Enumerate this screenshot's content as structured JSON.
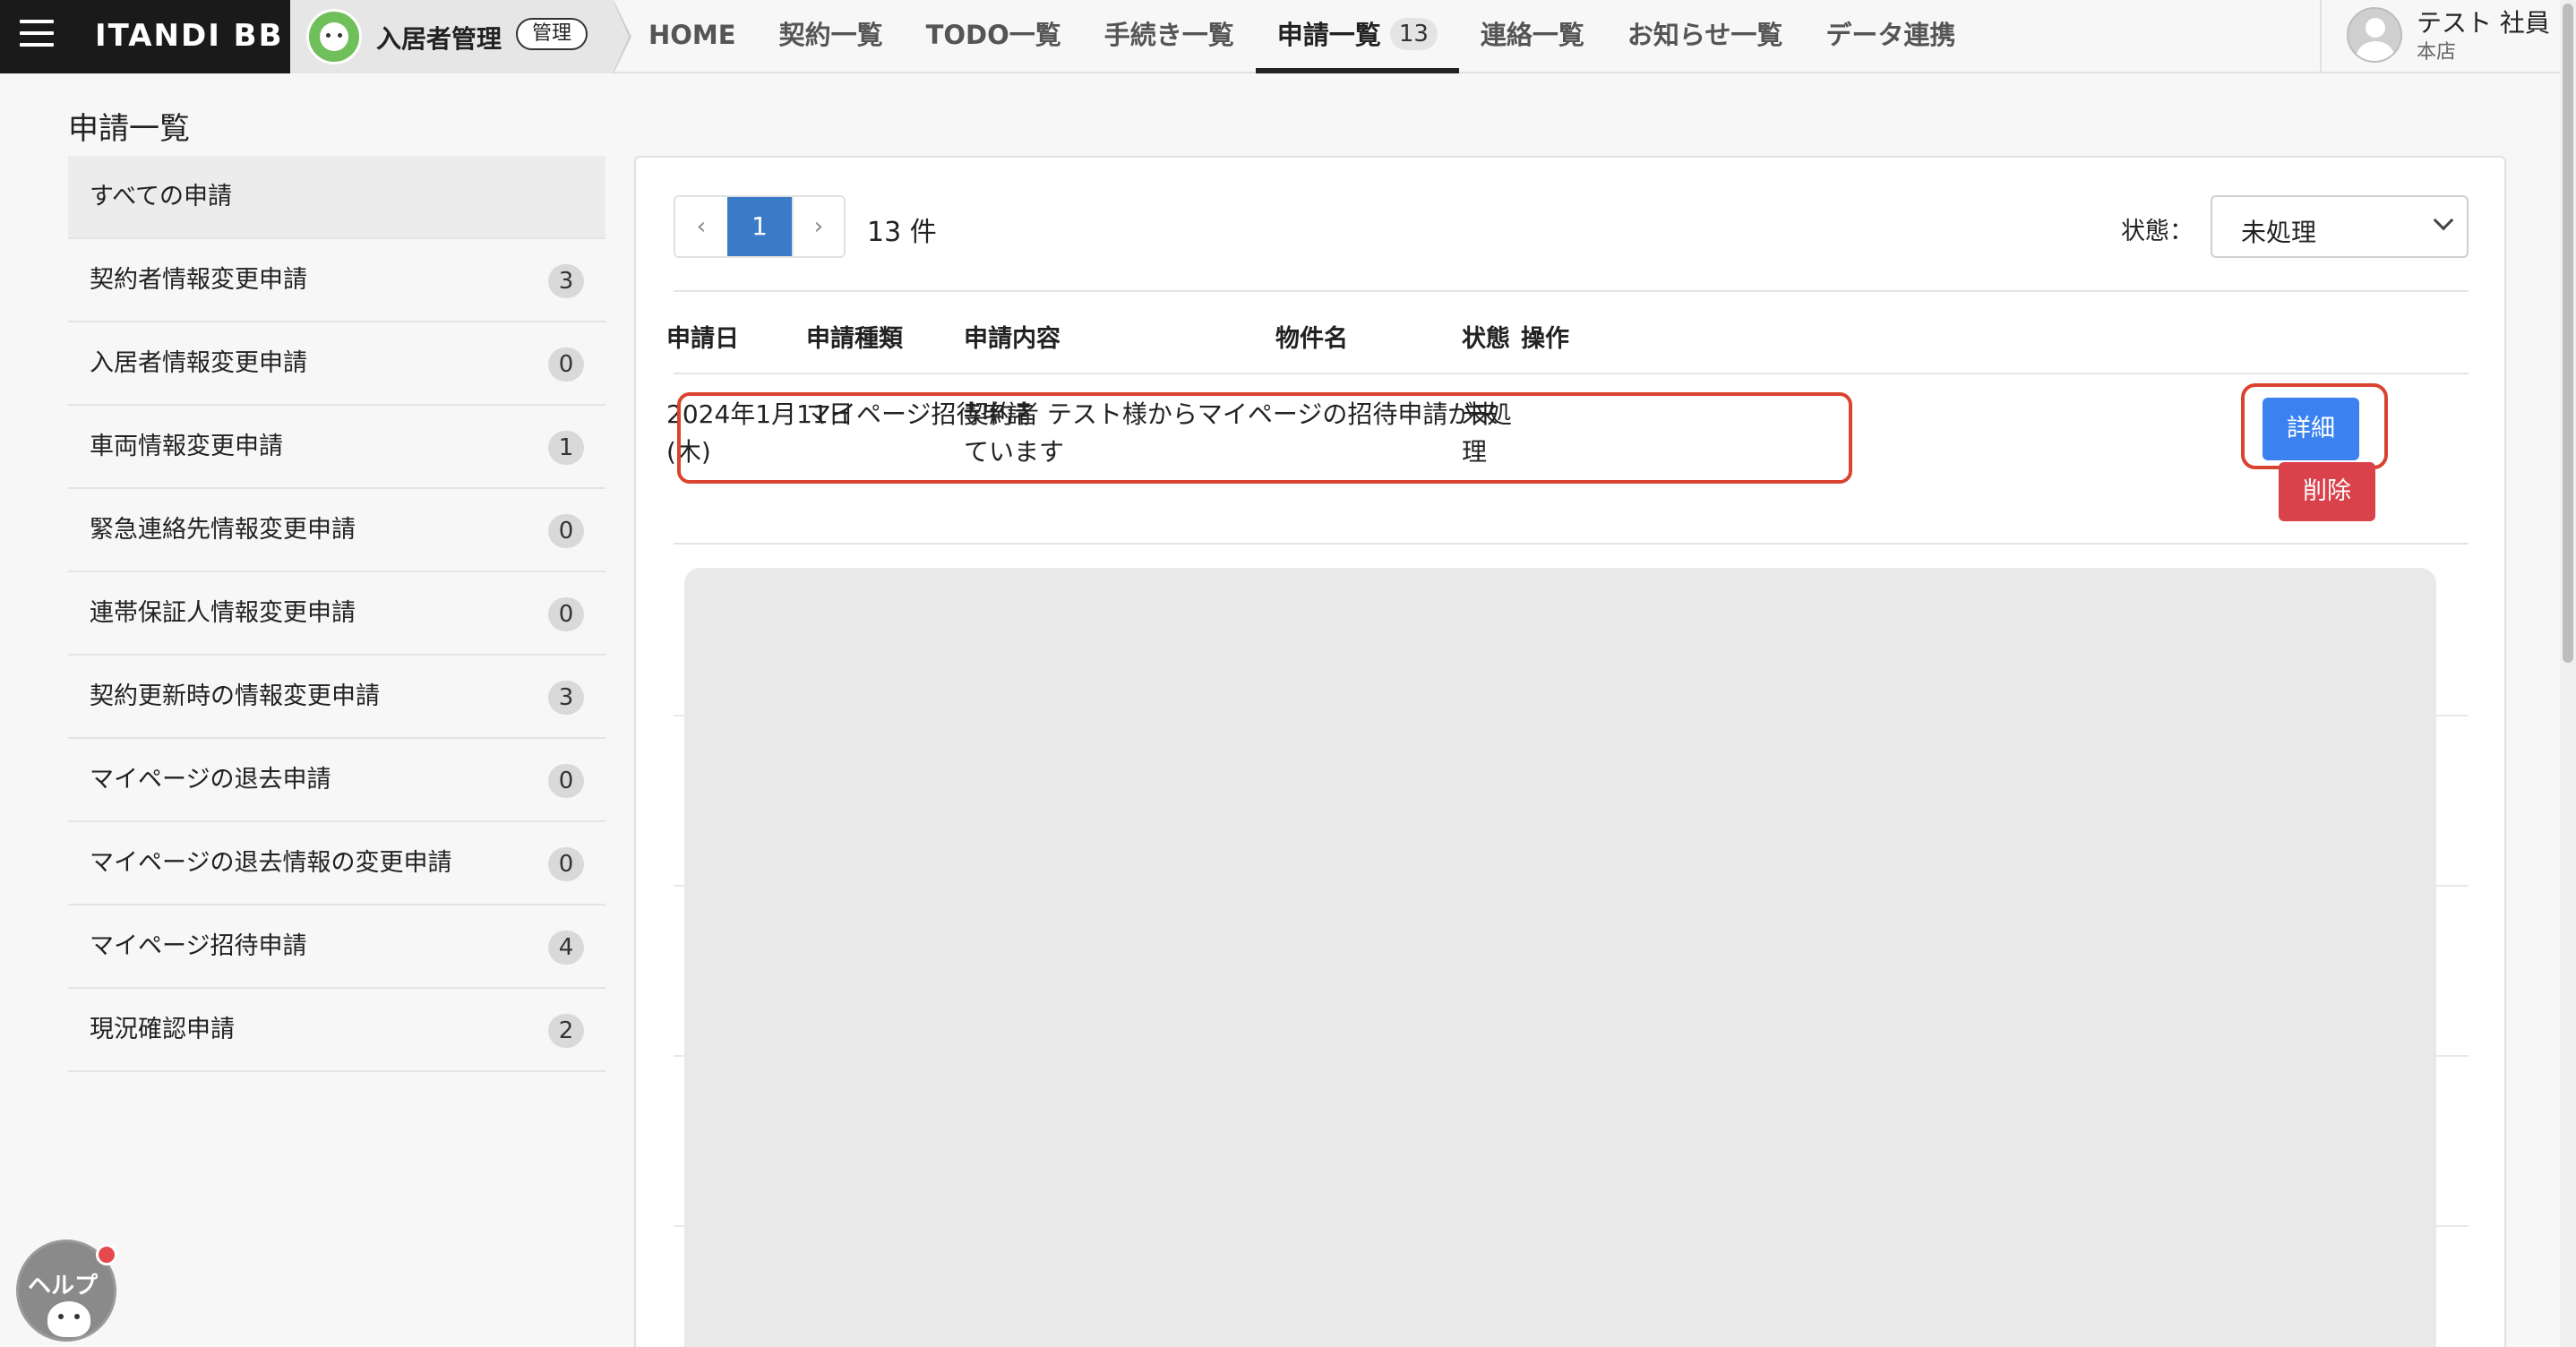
{
  "header": {
    "brand": "ITANDI BB",
    "app_name": "入居者管理",
    "admin_badge": "管理",
    "nav": [
      {
        "label": "HOME"
      },
      {
        "label": "契約一覧"
      },
      {
        "label": "TODO一覧"
      },
      {
        "label": "手続き一覧"
      },
      {
        "label": "申請一覧",
        "count": "13",
        "active": true
      },
      {
        "label": "連絡一覧"
      },
      {
        "label": "お知らせ一覧"
      },
      {
        "label": "データ連携"
      }
    ],
    "user": {
      "name": "テスト 社員",
      "branch": "本店"
    }
  },
  "page": {
    "title": "申請一覧"
  },
  "sidebar": {
    "items": [
      {
        "label": "すべての申請",
        "count": null,
        "active": true
      },
      {
        "label": "契約者情報変更申請",
        "count": "3"
      },
      {
        "label": "入居者情報変更申請",
        "count": "0"
      },
      {
        "label": "車両情報変更申請",
        "count": "1"
      },
      {
        "label": "緊急連絡先情報変更申請",
        "count": "0"
      },
      {
        "label": "連帯保証人情報変更申請",
        "count": "0"
      },
      {
        "label": "契約更新時の情報変更申請",
        "count": "3"
      },
      {
        "label": "マイページの退去申請",
        "count": "0"
      },
      {
        "label": "マイページの退去情報の変更申請",
        "count": "0"
      },
      {
        "label": "マイページ招待申請",
        "count": "4"
      },
      {
        "label": "現況確認申請",
        "count": "2"
      }
    ]
  },
  "pager": {
    "prev": "‹",
    "current": "1",
    "next": "›",
    "count_text": "13 件"
  },
  "filter": {
    "label": "状態：",
    "selected": "未処理"
  },
  "table": {
    "columns": [
      "申請日",
      "申請種類",
      "申請内容",
      "物件名",
      "状態",
      "操作"
    ],
    "rows": [
      {
        "date_line1": "2024年1月11日",
        "date_line2": "(木)",
        "type": "マイページ招待申請",
        "content_line1": "契約者 テスト様からマイページの招待申請が来",
        "content_line2": "ています",
        "property": "",
        "status_line1": "未処",
        "status_line2": "理",
        "detail_label": "詳細",
        "delete_label": "削除"
      }
    ]
  },
  "help": {
    "label": "ヘルプ"
  },
  "colors": {
    "primary": "#3b82f0",
    "danger": "#d9414b",
    "pager_active": "#3a7bc8",
    "highlight": "#d9432f",
    "brand_bg": "#1a1a1a"
  }
}
